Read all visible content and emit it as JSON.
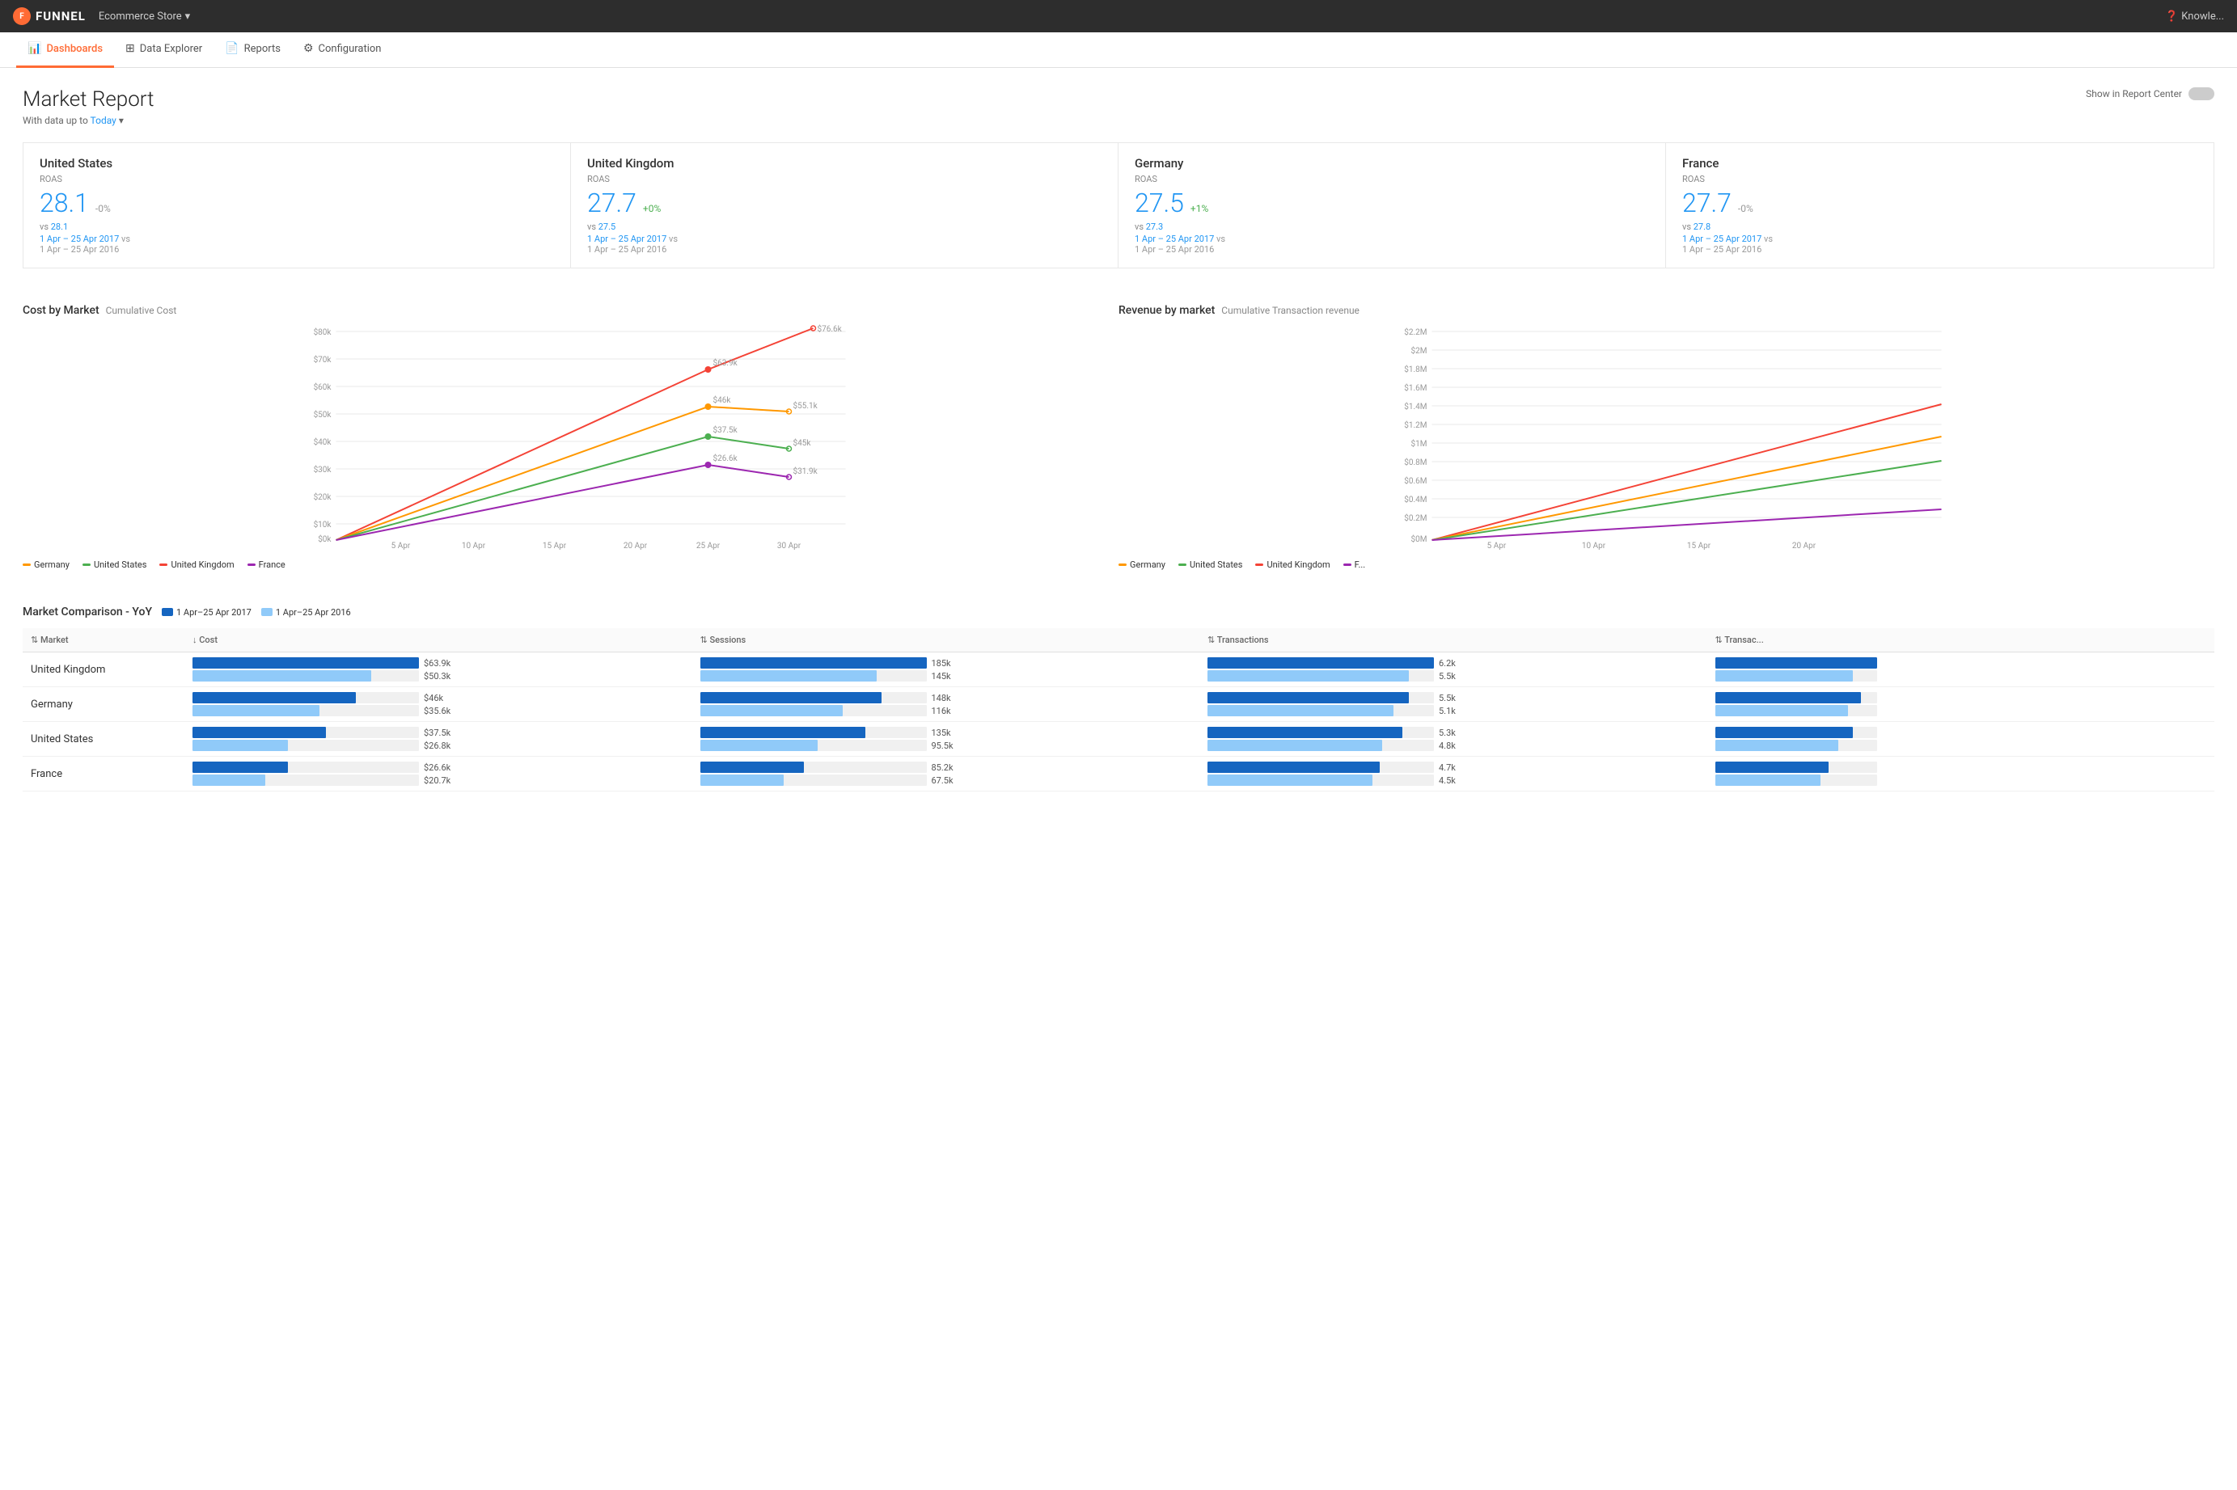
{
  "topbar": {
    "logo_text": "FUNNEL",
    "store_name": "Ecommerce Store",
    "dropdown_icon": "▾",
    "help_label": "Knowle..."
  },
  "subnav": {
    "items": [
      {
        "id": "dashboards",
        "label": "Dashboards",
        "icon": "📊",
        "active": true
      },
      {
        "id": "data-explorer",
        "label": "Data Explorer",
        "icon": "⊞",
        "active": false
      },
      {
        "id": "reports",
        "label": "Reports",
        "icon": "📄",
        "active": false
      },
      {
        "id": "configuration",
        "label": "Configuration",
        "icon": "⚙",
        "active": false
      }
    ]
  },
  "page": {
    "title": "Market Report",
    "subtitle": "With data up to",
    "today_label": "Today",
    "show_report_label": "Show in Report Center"
  },
  "kpi_cards": [
    {
      "country": "United States",
      "metric": "ROAS",
      "value": "28.1",
      "change": "-0%",
      "change_type": "neg",
      "vs_value": "28.1",
      "date_current": "1 Apr – 25 Apr 2017",
      "date_compare": "1 Apr – 25 Apr 2016"
    },
    {
      "country": "United Kingdom",
      "metric": "ROAS",
      "value": "27.7",
      "change": "+0%",
      "change_type": "pos",
      "vs_value": "27.5",
      "date_current": "1 Apr – 25 Apr 2017",
      "date_compare": "1 Apr – 25 Apr 2016"
    },
    {
      "country": "Germany",
      "metric": "ROAS",
      "value": "27.5",
      "change": "+1%",
      "change_type": "pos",
      "vs_value": "27.3",
      "date_current": "1 Apr – 25 Apr 2017",
      "date_compare": "1 Apr – 25 Apr 2016"
    },
    {
      "country": "France",
      "metric": "ROAS",
      "value": "27.7",
      "change": "-0%",
      "change_type": "neg",
      "vs_value": "27.8",
      "date_current": "1 Apr – 25 Apr 2017",
      "date_compare": "1 Apr – 25 Apr 2016"
    }
  ],
  "cost_chart": {
    "title": "Cost by Market",
    "subtitle": "Cumulative Cost",
    "y_labels": [
      "$80k",
      "$70k",
      "$60k",
      "$50k",
      "$40k",
      "$30k",
      "$20k",
      "$10k",
      "$0k"
    ],
    "x_labels": [
      "5 Apr",
      "10 Apr",
      "15 Apr",
      "20 Apr",
      "25 Apr",
      "30 Apr"
    ],
    "legend": [
      {
        "label": "Germany",
        "color": "#ff9800"
      },
      {
        "label": "United States",
        "color": "#4caf50"
      },
      {
        "label": "United Kingdom",
        "color": "#f44336"
      },
      {
        "label": "France",
        "color": "#9c27b0"
      }
    ],
    "annotations": [
      {
        "label": "$76.6k",
        "color": "#f44336"
      },
      {
        "label": "$63.9k",
        "color": "#f44336"
      },
      {
        "label": "$55.1k",
        "color": "#ff9800"
      },
      {
        "label": "$46k",
        "color": "#ff9800"
      },
      {
        "label": "$45k",
        "color": "#ff9800"
      },
      {
        "label": "$37.5k",
        "color": "#4caf50"
      },
      {
        "label": "$31.9k",
        "color": "#4caf50"
      },
      {
        "label": "$26.6k",
        "color": "#9c27b0"
      }
    ]
  },
  "revenue_chart": {
    "title": "Revenue by market",
    "subtitle": "Cumulative Transaction revenue",
    "y_labels": [
      "$2.2M",
      "$2M",
      "$1.8M",
      "$1.6M",
      "$1.4M",
      "$1.2M",
      "$1M",
      "$0.8M",
      "$0.6M",
      "$0.4M",
      "$0.2M",
      "$0M"
    ],
    "x_labels": [
      "5 Apr",
      "10 Apr",
      "15 Apr",
      "20 Apr"
    ],
    "legend": [
      {
        "label": "Germany",
        "color": "#ff9800"
      },
      {
        "label": "United States",
        "color": "#4caf50"
      },
      {
        "label": "United Kingdom",
        "color": "#f44336"
      },
      {
        "label": "France",
        "color": "#9c27b0"
      }
    ]
  },
  "comparison_table": {
    "title": "Market Comparison - YoY",
    "legend": [
      {
        "label": "1 Apr–25 Apr 2017",
        "color": "#1565c0"
      },
      {
        "label": "1 Apr–25 Apr 2016",
        "color": "#90caf9"
      }
    ],
    "columns": [
      {
        "id": "market",
        "label": "Market",
        "sort": "asc"
      },
      {
        "id": "cost",
        "label": "Cost",
        "sort": "desc"
      },
      {
        "id": "sessions",
        "label": "Sessions",
        "sort": "none"
      },
      {
        "id": "transactions",
        "label": "Transactions",
        "sort": "none"
      },
      {
        "id": "transac2",
        "label": "Transac...",
        "sort": "none"
      }
    ],
    "rows": [
      {
        "market": "United Kingdom",
        "cost_2017": 63900,
        "cost_2017_label": "$63.9k",
        "cost_2016": 50300,
        "cost_2016_label": "$50.3k",
        "sessions_2017": 185000,
        "sessions_2017_label": "185k",
        "sessions_2016": 145000,
        "sessions_2016_label": "145k",
        "transactions_2017": 6200,
        "transactions_2017_label": "6.2k",
        "transactions_2016": 5500,
        "transactions_2016_label": "5.5k"
      },
      {
        "market": "Germany",
        "cost_2017": 46000,
        "cost_2017_label": "$46k",
        "cost_2016": 35600,
        "cost_2016_label": "$35.6k",
        "sessions_2017": 148000,
        "sessions_2017_label": "148k",
        "sessions_2016": 116000,
        "sessions_2016_label": "116k",
        "transactions_2017": 5500,
        "transactions_2017_label": "5.5k",
        "transactions_2016": 5100,
        "transactions_2016_label": "5.1k"
      },
      {
        "market": "United States",
        "cost_2017": 37500,
        "cost_2017_label": "$37.5k",
        "cost_2016": 26800,
        "cost_2016_label": "$26.8k",
        "sessions_2017": 135000,
        "sessions_2017_label": "135k",
        "sessions_2016": 95500,
        "sessions_2016_label": "95.5k",
        "transactions_2017": 5300,
        "transactions_2017_label": "5.3k",
        "transactions_2016": 4800,
        "transactions_2016_label": "4.8k"
      },
      {
        "market": "France",
        "cost_2017": 26600,
        "cost_2017_label": "$26.6k",
        "cost_2016": 20700,
        "cost_2016_label": "$20.7k",
        "sessions_2017": 85200,
        "sessions_2017_label": "85.2k",
        "sessions_2016": 67500,
        "sessions_2016_label": "67.5k",
        "transactions_2017": 4700,
        "transactions_2017_label": "4.7k",
        "transactions_2016": 4500,
        "transactions_2016_label": "4.5k"
      }
    ]
  },
  "colors": {
    "accent": "#ff6b35",
    "blue": "#2196f3",
    "dark_blue": "#1565c0",
    "light_blue": "#90caf9",
    "green": "#4caf50",
    "red": "#f44336",
    "orange": "#ff9800",
    "purple": "#9c27b0"
  }
}
